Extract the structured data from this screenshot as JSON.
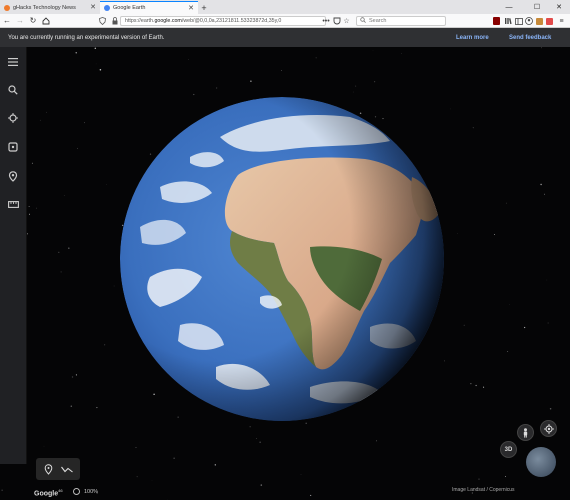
{
  "browser": {
    "tabs": [
      {
        "label": "gHacks Technology News",
        "active": false,
        "favicon_color": "#ef7a2c"
      },
      {
        "label": "Google Earth",
        "active": true,
        "favicon_color": "#4285f4"
      }
    ],
    "new_tab_label": "+",
    "window_controls": {
      "minimize": "—",
      "maximize": "☐",
      "close": "✕"
    },
    "address": {
      "prefix": "https://earth.",
      "domain": "google.com",
      "path": "/web/@0,0,0a,23121811.53323872d,35y,0"
    },
    "more_label": "•••",
    "search_placeholder": "Search"
  },
  "banner": {
    "message": "You are currently running an experimental version of Earth.",
    "learn_more": "Learn more",
    "send_feedback": "Send feedback"
  },
  "rail": {
    "items": [
      {
        "name": "menu-icon"
      },
      {
        "name": "search-icon"
      },
      {
        "name": "voyager-icon"
      },
      {
        "name": "feeling-lucky-icon"
      },
      {
        "name": "projects-icon"
      },
      {
        "name": "measure-icon"
      }
    ]
  },
  "controls": {
    "three_d_label": "3D"
  },
  "footer": {
    "google_logo": "Google",
    "google_logo_suffix": "46",
    "zoom_label": "100%",
    "attribution": "Image Landsat / Copernicus"
  },
  "colors": {
    "accent": "#8ab4f8",
    "banner_bg": "#2f3033",
    "rail_bg": "#202124",
    "ocean": "#3f74c2"
  }
}
